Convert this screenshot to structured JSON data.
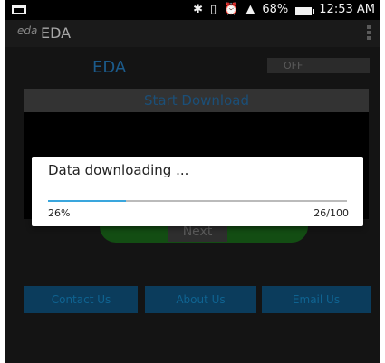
{
  "status_bar": {
    "battery": "68%",
    "time": "12:53 AM",
    "icons": [
      "notification-icon",
      "bluetooth-icon",
      "vibrate-icon",
      "alarm-icon",
      "signal-icon",
      "battery-icon"
    ]
  },
  "app_bar": {
    "logo": "eda",
    "title": "EDA"
  },
  "main": {
    "eda_label": "EDA",
    "toggle_label": "OFF",
    "start_download": "Start Download",
    "next": "Next",
    "buttons": {
      "contact": "Contact Us",
      "about": "About Us",
      "email": "Email Us"
    }
  },
  "dialog": {
    "message": "Data downloading ...",
    "percent": "26%",
    "count": "26/100",
    "progress": 0.26
  },
  "colors": {
    "accent": "#3aa6dd",
    "button_bg": "#0b3c5c"
  }
}
